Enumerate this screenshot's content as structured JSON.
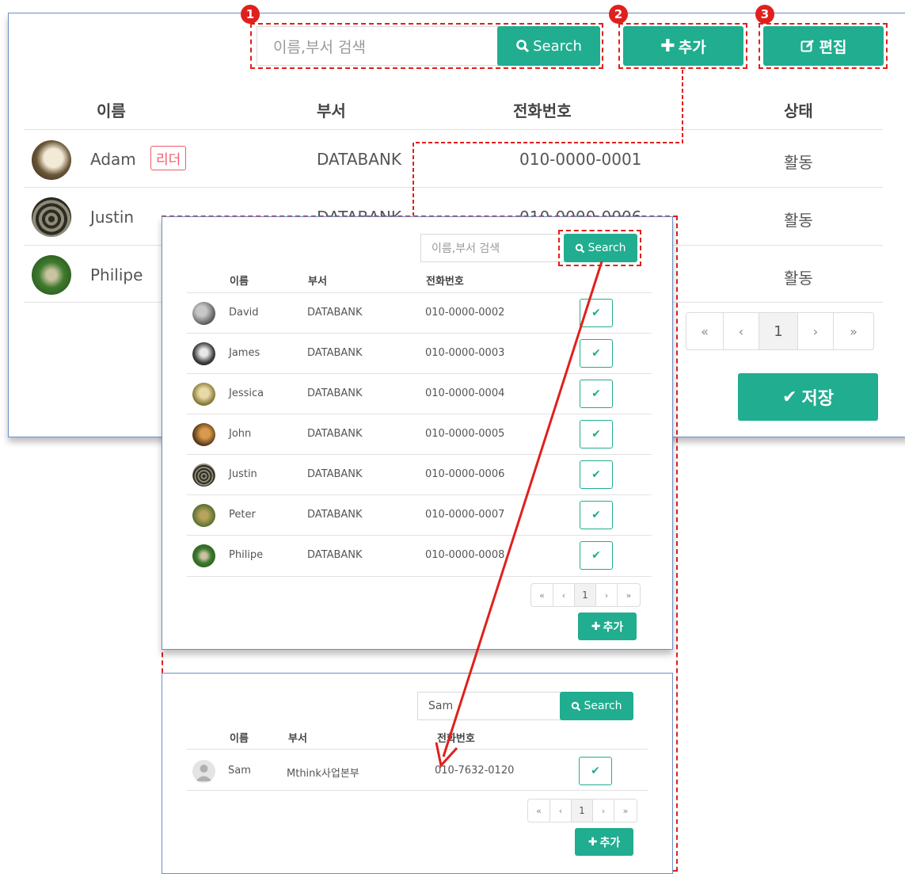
{
  "main": {
    "search_placeholder": "이름,부서 검색",
    "search_button": "Search",
    "add_button": "추가",
    "edit_button": "편집",
    "columns": [
      "이름",
      "부서",
      "전화번호",
      "상태"
    ],
    "rows": [
      {
        "name": "Adam",
        "badge": "리더",
        "dept": "DATABANK",
        "phone": "010-0000-0001",
        "status": "활동"
      },
      {
        "name": "Justin",
        "dept": "DATABANK",
        "phone": "010-0000-0006",
        "status": "활동"
      },
      {
        "name": "Philipe",
        "status": "활동"
      }
    ],
    "pager": {
      "first": "«",
      "prev": "‹",
      "page": "1",
      "next": "›",
      "last": "»"
    },
    "save_button": "저장"
  },
  "markers": [
    "1",
    "2",
    "3"
  ],
  "popup": {
    "search_placeholder": "이름,부서 검색",
    "search_button": "Search",
    "columns": [
      "이름",
      "부서",
      "전화번호"
    ],
    "rows": [
      {
        "name": "David",
        "dept": "DATABANK",
        "phone": "010-0000-0002"
      },
      {
        "name": "James",
        "dept": "DATABANK",
        "phone": "010-0000-0003"
      },
      {
        "name": "Jessica",
        "dept": "DATABANK",
        "phone": "010-0000-0004"
      },
      {
        "name": "John",
        "dept": "DATABANK",
        "phone": "010-0000-0005"
      },
      {
        "name": "Justin",
        "dept": "DATABANK",
        "phone": "010-0000-0006"
      },
      {
        "name": "Peter",
        "dept": "DATABANK",
        "phone": "010-0000-0007"
      },
      {
        "name": "Philipe",
        "dept": "DATABANK",
        "phone": "010-0000-0008"
      }
    ],
    "pager": {
      "first": "«",
      "prev": "‹",
      "page": "1",
      "next": "›",
      "last": "»"
    },
    "add_button": "추가"
  },
  "result": {
    "search_value": "Sam",
    "search_button": "Search",
    "columns": [
      "이름",
      "부서",
      "전화번호"
    ],
    "rows": [
      {
        "name": "Sam",
        "dept": "Mthink사업본부",
        "phone": "010-7632-0120"
      }
    ],
    "pager": {
      "first": "«",
      "prev": "‹",
      "page": "1",
      "next": "›",
      "last": "»"
    },
    "add_button": "추가"
  },
  "colors": {
    "accent": "#21ad8f",
    "annotation": "#e0201c",
    "panel_border": "#6b8fc4"
  },
  "icons": [
    "search-icon",
    "plus-icon",
    "edit-icon",
    "check-icon",
    "user-placeholder-icon"
  ]
}
